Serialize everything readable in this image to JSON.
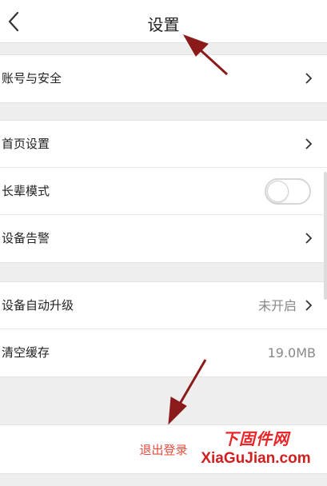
{
  "header": {
    "title": "设置",
    "back_icon": "chevron-left-icon"
  },
  "groups": [
    {
      "items": [
        {
          "label": "账号与安全",
          "icon": "chevron-right-icon"
        }
      ]
    },
    {
      "items": [
        {
          "label": "首页设置",
          "icon": "chevron-right-icon"
        },
        {
          "label": "长辈模式",
          "toggle": "off"
        },
        {
          "label": "设备告警",
          "icon": "chevron-right-icon"
        }
      ]
    },
    {
      "items": [
        {
          "label": "设备自动升级",
          "value": "未开启",
          "icon": "chevron-right-icon"
        },
        {
          "label": "清空缓存",
          "value": "19.0MB"
        }
      ]
    }
  ],
  "logout": {
    "label": "退出登录"
  },
  "watermark": {
    "cn": "下固件网",
    "en": "XiaGuJian.com"
  },
  "colors": {
    "logout": "#e74c3c",
    "annotation_arrow": "#8b1a1a",
    "watermark": "#d11f1f"
  }
}
